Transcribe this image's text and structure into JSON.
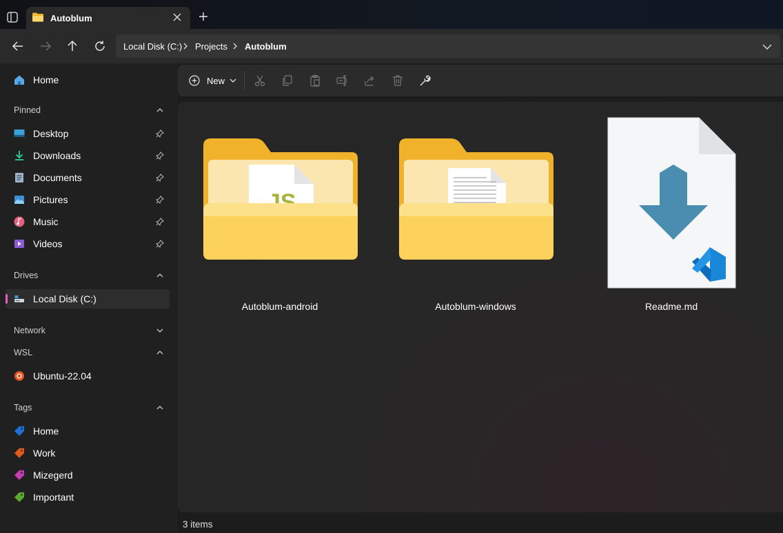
{
  "tab": {
    "title": "Autoblum"
  },
  "address": {
    "crumbs": [
      "Local Disk (C:)",
      "Projects",
      "Autoblum"
    ]
  },
  "sidebar": {
    "home": "Home",
    "pinned_header": "Pinned",
    "pinned": [
      {
        "label": "Desktop",
        "icon": "desktop-icon"
      },
      {
        "label": "Downloads",
        "icon": "downloads-icon"
      },
      {
        "label": "Documents",
        "icon": "documents-icon"
      },
      {
        "label": "Pictures",
        "icon": "pictures-icon"
      },
      {
        "label": "Music",
        "icon": "music-icon"
      },
      {
        "label": "Videos",
        "icon": "videos-icon"
      }
    ],
    "drives_header": "Drives",
    "drives": [
      {
        "label": "Local Disk (C:)",
        "selected": true
      }
    ],
    "network_header": "Network",
    "wsl_header": "WSL",
    "wsl": [
      {
        "label": "Ubuntu-22.04"
      }
    ],
    "tags_header": "Tags",
    "tags": [
      {
        "label": "Home",
        "color": "#1e6fd0"
      },
      {
        "label": "Work",
        "color": "#e05a1c"
      },
      {
        "label": "Mizegerd",
        "color": "#c23eb0"
      },
      {
        "label": "Important",
        "color": "#5aa832"
      }
    ]
  },
  "toolbar": {
    "new_label": "New",
    "actions": [
      "cut-icon",
      "copy-icon",
      "paste-icon",
      "rename-icon",
      "share-icon",
      "delete-icon",
      "properties-icon"
    ]
  },
  "files": [
    {
      "name": "Autoblum-android",
      "type": "folder"
    },
    {
      "name": "Autoblum-windows",
      "type": "folder"
    },
    {
      "name": "Readme.md",
      "type": "markdown-file"
    }
  ],
  "status": {
    "count": "3 items"
  },
  "colors": {
    "accent": "#e65fc6",
    "folder": "#fcc93b",
    "md_arrow": "#4a8db0",
    "vscode": "#1a86d8"
  }
}
